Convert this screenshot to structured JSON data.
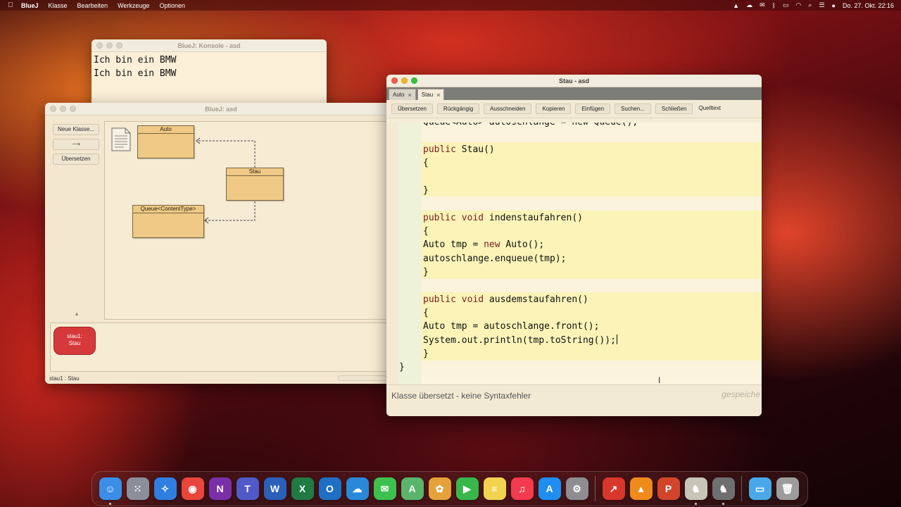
{
  "menubar": {
    "apple": "",
    "app": "BlueJ",
    "items": [
      "Klasse",
      "Bearbeiten",
      "Werkzeuge",
      "Optionen"
    ],
    "clock": "Do. 27. Okt.  22:16"
  },
  "console_window": {
    "title": "BlueJ: Konsole - asd",
    "lines": [
      "Ich bin ein BMW",
      "Ich bin ein BMW"
    ]
  },
  "project_window": {
    "title": "BlueJ: asd",
    "buttons": {
      "new_class": "Neue Klasse...",
      "arrow": "⟶",
      "compile": "Übersetzen"
    },
    "classes": {
      "auto": "Auto",
      "stau": "Stau",
      "queue": "Queue<ContentType>"
    },
    "object": {
      "line1": "stau1:",
      "line2": "Stau"
    },
    "status": "stau1 : Stau"
  },
  "editor_window": {
    "title": "Stau - asd",
    "tabs": [
      "Auto",
      "Stau"
    ],
    "toolbar": [
      "Übersetzen",
      "Rückgängig",
      "Ausschneiden",
      "Kopieren",
      "Einfügen",
      "Suchen...",
      "Schließen",
      "Quelltext"
    ],
    "code": {
      "l0": "Queue<Auto> autoschlange = new Queue();",
      "l1_kw": "public",
      "l1_rest": " Stau()",
      "l2": "{",
      "l4": "}",
      "l6_kw": "public void",
      "l6_rest": " indenstaufahren()",
      "l7": "{",
      "l8_a": "Auto tmp = ",
      "l8_kw": "new",
      "l8_b": " Auto();",
      "l9": "autoschlange.enqueue(tmp);",
      "l10": "}",
      "l12_kw": "public void",
      "l12_rest": " ausdemstaufahren()",
      "l13": "{",
      "l14": "Auto tmp = autoschlange.front();",
      "l15": "System.out.println(tmp.toString());",
      "l16": "}",
      "l17": "}"
    },
    "status_message": "Klasse übersetzt - keine Syntaxfehler",
    "saved_label": "gespeiche"
  },
  "dock": {
    "apps": [
      {
        "name": "finder-icon",
        "color": "#3a8ee8",
        "glyph": "☺"
      },
      {
        "name": "launchpad-icon",
        "color": "#8a8f9a",
        "glyph": "⁙"
      },
      {
        "name": "safari-icon",
        "color": "#2f7fe0",
        "glyph": "✧"
      },
      {
        "name": "chrome-icon",
        "color": "#e8453c",
        "glyph": "◉"
      },
      {
        "name": "onenote-icon",
        "color": "#7a2fa8",
        "glyph": "N"
      },
      {
        "name": "teams-icon",
        "color": "#5059c9",
        "glyph": "T"
      },
      {
        "name": "word-icon",
        "color": "#2b5fb8",
        "glyph": "W"
      },
      {
        "name": "excel-icon",
        "color": "#1f7a43",
        "glyph": "X"
      },
      {
        "name": "outlook-icon",
        "color": "#1f6fc4",
        "glyph": "O"
      },
      {
        "name": "onedrive-icon",
        "color": "#2a88d8",
        "glyph": "☁"
      },
      {
        "name": "messages-icon",
        "color": "#3cc14e",
        "glyph": "✉"
      },
      {
        "name": "maps-icon",
        "color": "#5ab56a",
        "glyph": "A"
      },
      {
        "name": "photos-icon",
        "color": "#e5a13a",
        "glyph": "✿"
      },
      {
        "name": "facetime-icon",
        "color": "#37b64a",
        "glyph": "▶"
      },
      {
        "name": "notes-icon",
        "color": "#f2d350",
        "glyph": "≡"
      },
      {
        "name": "music-icon",
        "color": "#f23b4e",
        "glyph": "♫"
      },
      {
        "name": "appstore-icon",
        "color": "#1f8ef0",
        "glyph": "A"
      },
      {
        "name": "settings-icon",
        "color": "#8d8d92",
        "glyph": "⚙"
      }
    ],
    "apps2": [
      {
        "name": "remote-desktop-icon",
        "color": "#d8372b",
        "glyph": "↗"
      },
      {
        "name": "vlc-icon",
        "color": "#f08a1a",
        "glyph": "▲"
      },
      {
        "name": "powerpoint-icon",
        "color": "#d2452b",
        "glyph": "P"
      },
      {
        "name": "bluej-icon",
        "color": "#c9c4b8",
        "glyph": "♞"
      },
      {
        "name": "preview-icon",
        "color": "#6f6f70",
        "glyph": "♞"
      }
    ],
    "apps3": [
      {
        "name": "downloads-folder-icon",
        "color": "#4aa8e8",
        "glyph": "▭"
      },
      {
        "name": "trash-icon",
        "color": "#9c9c9c",
        "glyph": "🗑"
      }
    ]
  }
}
